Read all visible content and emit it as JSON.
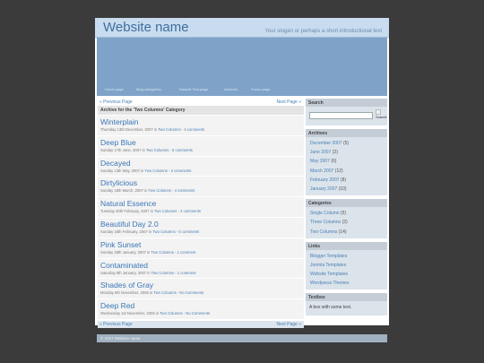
{
  "header": {
    "site_name": "Website name",
    "slogan": "Your slogan or perhaps a short introductional text"
  },
  "nav": [
    "Home page",
    "Blog categories",
    "Sample Text page",
    "Archives",
    "Forum page"
  ],
  "pager": {
    "prev": "« Previous Page",
    "next": "Next Page »"
  },
  "archive_title": "Archive for the 'Two Columns' Category",
  "posts": [
    {
      "title": "Winterplain",
      "date": "Thursday 13th December, 2007",
      "category": "Two Columns",
      "comments": "4 comments"
    },
    {
      "title": "Deep Blue",
      "date": "Sunday 17th June, 2007",
      "category": "Two Columns",
      "comments": "5 comments"
    },
    {
      "title": "Decayed",
      "date": "Sunday 13th May, 2007",
      "category": "Two Columns",
      "comments": "2 comments"
    },
    {
      "title": "Dirtylicious",
      "date": "Sunday 18th March, 2007",
      "category": "Two Columns",
      "comments": "4 comments"
    },
    {
      "title": "Natural Essence",
      "date": "Tuesday 20th February, 2007",
      "category": "Two Columns",
      "comments": "4 comments"
    },
    {
      "title": "Beautiful Day 2.0",
      "date": "Sunday 18th February, 2007",
      "category": "Two Columns",
      "comments": "5 comments"
    },
    {
      "title": "Pink Sunset",
      "date": "Sunday 28th January, 2007",
      "category": "Two Columns",
      "comments": "1 comment"
    },
    {
      "title": "Contaminated",
      "date": "Saturday 6th January, 2007",
      "category": "Two Columns",
      "comments": "1 comment"
    },
    {
      "title": "Shades of Gray",
      "date": "Monday 6th November, 2006",
      "category": "Two Columns",
      "comments": "No Comments"
    },
    {
      "title": "Deep Red",
      "date": "Wednesday 1st November, 2006",
      "category": "Two Columns",
      "comments": "No Comments"
    }
  ],
  "post_meta_in": "in",
  "sidebar": {
    "search": {
      "title": "Search",
      "button": "Submit"
    },
    "archives": {
      "title": "Archives",
      "items": [
        {
          "label": "December 2007",
          "count": "(5)"
        },
        {
          "label": "June 2007",
          "count": "(2)"
        },
        {
          "label": "May 2007",
          "count": "(6)"
        },
        {
          "label": "March 2007",
          "count": "(12)"
        },
        {
          "label": "February 2007",
          "count": "(8)"
        },
        {
          "label": "January 2007",
          "count": "(10)"
        }
      ]
    },
    "categories": {
      "title": "Categories",
      "items": [
        {
          "label": "Single Column",
          "count": "(5)"
        },
        {
          "label": "Three Columns",
          "count": "(2)"
        },
        {
          "label": "Two Columns",
          "count": "(14)"
        }
      ]
    },
    "links": {
      "title": "Links",
      "items": [
        "Blogger Templates",
        "Joomla Templates",
        "Website Templates",
        "Wordpress Themes"
      ]
    },
    "textbox": {
      "title": "Textbox",
      "body": "A box with some text."
    }
  },
  "footer": "© 2017 Website name",
  "colors": {
    "background": "#3b3b3b",
    "banner": "#7fa3c8",
    "link": "#3a76b6",
    "header": "#c9dcef"
  }
}
